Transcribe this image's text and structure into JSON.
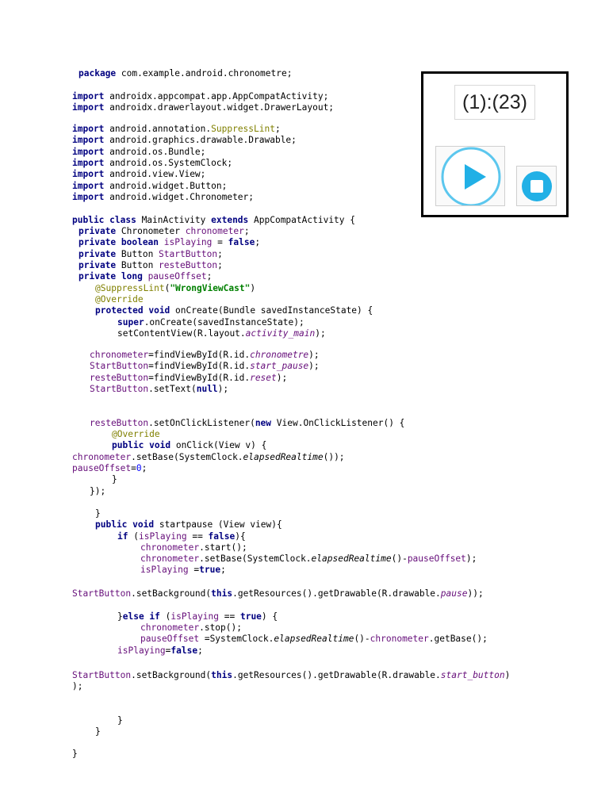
{
  "code_lines": [
    [
      [
        "kw",
        "package"
      ],
      [
        "pl",
        " com.example.android.chronometre;"
      ]
    ],
    [
      [
        "kw",
        "import"
      ],
      [
        "pl",
        " androidx.appcompat.app.AppCompatActivity;"
      ]
    ],
    [
      [
        "kw",
        "import"
      ],
      [
        "pl",
        " androidx.drawerlayout.widget.DrawerLayout;"
      ]
    ],
    [
      [
        "kw",
        "import"
      ],
      [
        "pl",
        " android.annotation."
      ],
      [
        "an",
        "SuppressLint"
      ],
      [
        "pl",
        ";"
      ]
    ],
    [
      [
        "kw",
        "import"
      ],
      [
        "pl",
        " android.graphics.drawable.Drawable;"
      ]
    ],
    [
      [
        "kw",
        "import"
      ],
      [
        "pl",
        " android.os.Bundle;"
      ]
    ],
    [
      [
        "kw",
        "import"
      ],
      [
        "pl",
        " android.os.SystemClock;"
      ]
    ],
    [
      [
        "kw",
        "import"
      ],
      [
        "pl",
        " android.view.View;"
      ]
    ],
    [
      [
        "kw",
        "import"
      ],
      [
        "pl",
        " android.widget.Button;"
      ]
    ],
    [
      [
        "kw",
        "import"
      ],
      [
        "pl",
        " android.widget.Chronometer;"
      ]
    ],
    [
      [
        "kw",
        "public class"
      ],
      [
        "pl",
        " MainActivity "
      ],
      [
        "kw",
        "extends"
      ],
      [
        "pl",
        " AppCompatActivity {"
      ]
    ],
    [
      [
        "kw",
        "private"
      ],
      [
        "pl",
        " Chronometer "
      ],
      [
        "fd",
        "chronometer"
      ],
      [
        "pl",
        ";"
      ]
    ],
    [
      [
        "kw",
        "private boolean"
      ],
      [
        "fd",
        " isPlaying"
      ],
      [
        "pl",
        " = "
      ],
      [
        "kw",
        "false"
      ],
      [
        "pl",
        ";"
      ]
    ],
    [
      [
        "kw",
        "private"
      ],
      [
        "pl",
        " Button "
      ],
      [
        "fd",
        "StartButton"
      ],
      [
        "pl",
        ";"
      ]
    ],
    [
      [
        "kw",
        "private"
      ],
      [
        "pl",
        " Button "
      ],
      [
        "fd",
        "resteButton"
      ],
      [
        "pl",
        ";"
      ]
    ],
    [
      [
        "kw",
        "private long"
      ],
      [
        "fd",
        " pauseOffset"
      ],
      [
        "pl",
        ";"
      ]
    ],
    [
      [
        "an",
        "@SuppressLint"
      ],
      [
        "pl",
        "("
      ],
      [
        "st",
        "\"WrongViewCast\""
      ],
      [
        "pl",
        ")"
      ]
    ],
    [
      [
        "an",
        "@Override"
      ]
    ],
    [
      [
        "kw",
        "protected void"
      ],
      [
        "pl",
        " onCreate(Bundle savedInstanceState) {"
      ]
    ],
    [
      [
        "kw",
        "super"
      ],
      [
        "pl",
        ".onCreate(savedInstanceState);"
      ]
    ],
    [
      [
        "pl",
        "setContentView(R.layout."
      ],
      [
        "fi",
        "activity_main"
      ],
      [
        "pl",
        ");"
      ]
    ],
    [
      [
        "fd",
        "chronometer"
      ],
      [
        "pl",
        "=findViewById(R.id."
      ],
      [
        "fi",
        "chronometre"
      ],
      [
        "pl",
        ");"
      ]
    ],
    [
      [
        "fd",
        "StartButton"
      ],
      [
        "pl",
        "=findViewById(R.id."
      ],
      [
        "fi",
        "start_pause"
      ],
      [
        "pl",
        ");"
      ]
    ],
    [
      [
        "fd",
        "resteButton"
      ],
      [
        "pl",
        "=findViewById(R.id."
      ],
      [
        "fi",
        "reset"
      ],
      [
        "pl",
        ");"
      ]
    ],
    [
      [
        "fd",
        "StartButton"
      ],
      [
        "pl",
        ".setText("
      ],
      [
        "kw",
        "null"
      ],
      [
        "pl",
        ");"
      ]
    ],
    [
      [
        "fd",
        "resteButton"
      ],
      [
        "pl",
        ".setOnClickListener("
      ],
      [
        "kw",
        "new"
      ],
      [
        "pl",
        " View.OnClickListener() {"
      ]
    ],
    [
      [
        "an",
        "@Override"
      ]
    ],
    [
      [
        "kw",
        "public void"
      ],
      [
        "pl",
        " onClick(View v) {"
      ]
    ],
    [
      [
        "fd",
        "chronometer"
      ],
      [
        "pl",
        ".setBase(SystemClock."
      ],
      [
        "it",
        "elapsedRealtime"
      ],
      [
        "pl",
        "());"
      ]
    ],
    [
      [
        "fd",
        "pauseOffset"
      ],
      [
        "pl",
        "="
      ],
      [
        "nm",
        "0"
      ],
      [
        "pl",
        ";"
      ]
    ],
    [
      [
        "pl",
        "}"
      ]
    ],
    [
      [
        "pl",
        "});"
      ]
    ],
    [
      [
        "pl",
        "}"
      ]
    ],
    [
      [
        "kw",
        "public void"
      ],
      [
        "pl",
        " startpause (View view){"
      ]
    ],
    [
      [
        "kw",
        "if"
      ],
      [
        "pl",
        " ("
      ],
      [
        "fd",
        "isPlaying"
      ],
      [
        "pl",
        " == "
      ],
      [
        "kw",
        "false"
      ],
      [
        "pl",
        "){"
      ]
    ],
    [
      [
        "fd",
        "chronometer"
      ],
      [
        "pl",
        ".start();"
      ]
    ],
    [
      [
        "fd",
        "chronometer"
      ],
      [
        "pl",
        ".setBase(SystemClock."
      ],
      [
        "it",
        "elapsedRealtime"
      ],
      [
        "pl",
        "()-"
      ],
      [
        "fd",
        "pauseOffset"
      ],
      [
        "pl",
        ");"
      ]
    ],
    [
      [
        "fd",
        "isPlaying"
      ],
      [
        "pl",
        " ="
      ],
      [
        "kw",
        "true"
      ],
      [
        "pl",
        ";"
      ]
    ],
    [
      [
        "fd",
        "StartButton"
      ],
      [
        "pl",
        ".setBackground("
      ],
      [
        "kw",
        "this"
      ],
      [
        "pl",
        ".getResources().getDrawable(R.drawable."
      ],
      [
        "fi",
        "pause"
      ],
      [
        "pl",
        "));"
      ]
    ],
    [
      [
        "pl",
        "}"
      ],
      [
        "kw",
        "else if"
      ],
      [
        "pl",
        " ("
      ],
      [
        "fd",
        "isPlaying"
      ],
      [
        "pl",
        " == "
      ],
      [
        "kw",
        "true"
      ],
      [
        "pl",
        ") {"
      ]
    ],
    [
      [
        "fd",
        "chronometer"
      ],
      [
        "pl",
        ".stop();"
      ]
    ],
    [
      [
        "fd",
        "pauseOffset"
      ],
      [
        "pl",
        " =SystemClock."
      ],
      [
        "it",
        "elapsedRealtime"
      ],
      [
        "pl",
        "()-"
      ],
      [
        "fd",
        "chronometer"
      ],
      [
        "pl",
        ".getBase();"
      ]
    ],
    [
      [
        "fd",
        "isPlaying"
      ],
      [
        "pl",
        "="
      ],
      [
        "kw",
        "false"
      ],
      [
        "pl",
        ";"
      ]
    ],
    [
      [
        "fd",
        "StartButton"
      ],
      [
        "pl",
        ".setBackground("
      ],
      [
        "kw",
        "this"
      ],
      [
        "pl",
        ".getResources().getDrawable(R.drawable."
      ],
      [
        "fi",
        "start_button"
      ],
      [
        "pl",
        ")"
      ]
    ],
    [
      [
        "pl",
        ");"
      ]
    ],
    [
      [
        "pl",
        "}"
      ]
    ],
    [
      [
        "pl",
        "}"
      ]
    ],
    [
      [
        "pl",
        "}"
      ]
    ]
  ],
  "preview": {
    "chronometer_text": "(1):(23)",
    "colors": {
      "play_ring": "#5cc7ee",
      "play_fill": "#ffffff",
      "play_triangle": "#21b0e6",
      "stop_circle": "#21b0e6",
      "stop_square": "#ffffff"
    },
    "start_button_icon": "play-icon",
    "reset_button_icon": "stop-icon"
  }
}
